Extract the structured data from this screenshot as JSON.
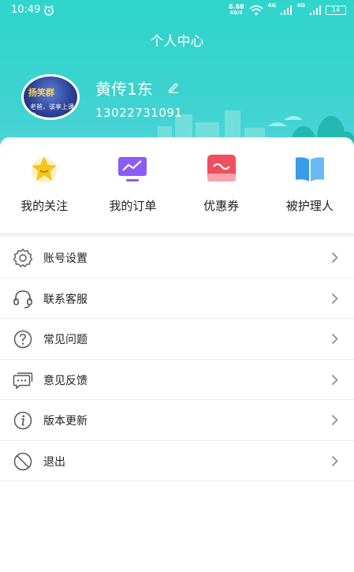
{
  "status_bar": {
    "time": "10:49",
    "net_speed_value": "6.68",
    "net_speed_unit": "KB/S",
    "signal_1": "4G",
    "signal_2": "4G",
    "battery": "14"
  },
  "header": {
    "title": "个人中心",
    "avatar_text_1": "扬笑群",
    "avatar_text_2": "老爸，该享上课了",
    "user_name": "黄传1东",
    "user_phone": "13022731091"
  },
  "quick_actions": [
    {
      "label": "我的关注",
      "icon": "star-icon"
    },
    {
      "label": "我的订单",
      "icon": "monitor-icon"
    },
    {
      "label": "优惠券",
      "icon": "coupon-icon"
    },
    {
      "label": "被护理人",
      "icon": "book-icon"
    }
  ],
  "menu": [
    {
      "label": "账号设置",
      "icon": "gear-icon"
    },
    {
      "label": "联系客服",
      "icon": "headset-icon"
    },
    {
      "label": "常见问题",
      "icon": "question-icon"
    },
    {
      "label": "意见反馈",
      "icon": "feedback-icon"
    },
    {
      "label": "版本更新",
      "icon": "info-icon"
    },
    {
      "label": "退出",
      "icon": "logout-icon"
    }
  ],
  "colors": {
    "header_bg": "#2fd5cb",
    "star": "#f5c518",
    "monitor": "#8b5cf6",
    "coupon": "#ef4f5f",
    "book": "#3a9be8"
  }
}
